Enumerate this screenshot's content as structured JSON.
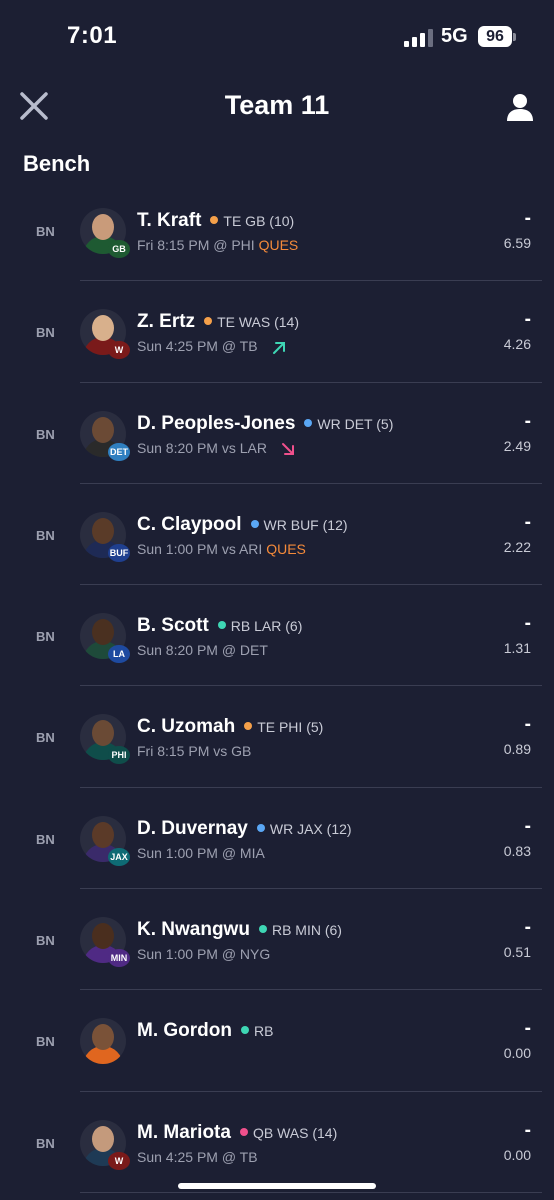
{
  "status": {
    "time": "7:01",
    "network": "5G",
    "battery": "96"
  },
  "header": {
    "title": "Team 11"
  },
  "section": {
    "title": "Bench"
  },
  "colors": {
    "TE": "#f5a04a",
    "WR": "#5aa7f5",
    "RB": "#3ed6b4",
    "QB": "#f0508c",
    "ques": "#f58a3a",
    "up": "#3ed6b4",
    "down": "#f0508c"
  },
  "players": [
    {
      "slot": "BN",
      "name": "T. Kraft",
      "pos": "TE",
      "team_info": "TE GB (10)",
      "game": "Fri 8:15 PM @ PHI",
      "status": "QUES",
      "trend": "",
      "proj": "-",
      "pts": "6.59",
      "team_abbr": "GB",
      "logo_color": "#1e5a32",
      "icon": "player-photo"
    },
    {
      "slot": "BN",
      "name": "Z. Ertz",
      "pos": "TE",
      "team_info": "TE WAS (14)",
      "game": "Sun 4:25 PM @ TB",
      "status": "",
      "trend": "up",
      "proj": "-",
      "pts": "4.26",
      "team_abbr": "W",
      "logo_color": "#7a1a1a",
      "icon": "player-photo"
    },
    {
      "slot": "BN",
      "name": "D. Peoples-Jones",
      "pos": "WR",
      "team_info": "WR DET (5)",
      "game": "Sun 8:20 PM vs LAR",
      "status": "",
      "trend": "down",
      "proj": "-",
      "pts": "2.49",
      "team_abbr": "DET",
      "logo_color": "#2f7fc0",
      "icon": "player-photo"
    },
    {
      "slot": "BN",
      "name": "C. Claypool",
      "pos": "WR",
      "team_info": "WR BUF (12)",
      "game": "Sun 1:00 PM vs ARI",
      "status": "QUES",
      "trend": "",
      "proj": "-",
      "pts": "2.22",
      "team_abbr": "BUF",
      "logo_color": "#1f3f8f",
      "icon": "player-photo"
    },
    {
      "slot": "BN",
      "name": "B. Scott",
      "pos": "RB",
      "team_info": "RB LAR (6)",
      "game": "Sun 8:20 PM @ DET",
      "status": "",
      "trend": "",
      "proj": "-",
      "pts": "1.31",
      "team_abbr": "LA",
      "logo_color": "#1e4aa0",
      "icon": "player-photo"
    },
    {
      "slot": "BN",
      "name": "C. Uzomah",
      "pos": "TE",
      "team_info": "TE PHI (5)",
      "game": "Fri 8:15 PM vs GB",
      "status": "",
      "trend": "",
      "proj": "-",
      "pts": "0.89",
      "team_abbr": "PHI",
      "logo_color": "#0f4d4a",
      "icon": "player-photo"
    },
    {
      "slot": "BN",
      "name": "D. Duvernay",
      "pos": "WR",
      "team_info": "WR JAX (12)",
      "game": "Sun 1:00 PM @ MIA",
      "status": "",
      "trend": "",
      "proj": "-",
      "pts": "0.83",
      "team_abbr": "JAX",
      "logo_color": "#0e6a74",
      "icon": "player-photo"
    },
    {
      "slot": "BN",
      "name": "K. Nwangwu",
      "pos": "RB",
      "team_info": "RB MIN (6)",
      "game": "Sun 1:00 PM @ NYG",
      "status": "",
      "trend": "",
      "proj": "-",
      "pts": "0.51",
      "team_abbr": "MIN",
      "logo_color": "#4f2a84",
      "icon": "player-photo"
    },
    {
      "slot": "BN",
      "name": "M. Gordon",
      "pos": "RB",
      "team_info": "RB",
      "game": "",
      "status": "",
      "trend": "",
      "proj": "-",
      "pts": "0.00",
      "team_abbr": "",
      "logo_color": "",
      "icon": "player-photo"
    },
    {
      "slot": "BN",
      "name": "M. Mariota",
      "pos": "QB",
      "team_info": "QB WAS (14)",
      "game": "Sun 4:25 PM @ TB",
      "status": "",
      "trend": "",
      "proj": "-",
      "pts": "0.00",
      "team_abbr": "W",
      "logo_color": "#7a1a1a",
      "icon": "player-photo"
    }
  ]
}
